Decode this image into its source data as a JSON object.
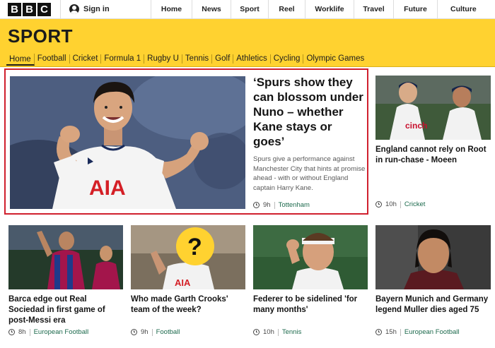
{
  "topbar": {
    "logo_letters": [
      "B",
      "B",
      "C"
    ],
    "signin_label": "Sign in",
    "nav": [
      "Home",
      "News",
      "Sport",
      "Reel",
      "Worklife",
      "Travel",
      "Future",
      "Culture"
    ]
  },
  "banner": {
    "title": "SPORT"
  },
  "subnav": [
    "Home",
    "Football",
    "Cricket",
    "Formula 1",
    "Rugby U",
    "Tennis",
    "Golf",
    "Athletics",
    "Cycling",
    "Olympic Games"
  ],
  "hero": {
    "headline": "‘Spurs show they can blossom under Nuno – whether Kane stays or goes’",
    "summary": "Spurs give a performance against Manchester City that hints at promise ahead - with or without England captain Harry Kane.",
    "time": "9h",
    "tag": "Tottenham",
    "image_shirt_text": "AIA"
  },
  "side": {
    "title": "England cannot rely on Root in run-chase - Moeen",
    "time": "10h",
    "tag": "Cricket"
  },
  "cards": [
    {
      "title": "Barca edge out Real Sociedad in first game of post-Messi era",
      "time": "8h",
      "tag": "European Football"
    },
    {
      "title": "Who made Garth Crooks' team of the week?",
      "time": "9h",
      "tag": "Football",
      "badge": "?"
    },
    {
      "title": "Federer to be sidelined 'for many months'",
      "time": "10h",
      "tag": "Tennis"
    },
    {
      "title": "Bayern Munich and Germany legend Muller dies aged 75",
      "time": "15h",
      "tag": "European Football"
    }
  ],
  "colors": {
    "accent": "#ffd230",
    "highlight": "#d0202e",
    "tag": "#1d6a4d"
  }
}
